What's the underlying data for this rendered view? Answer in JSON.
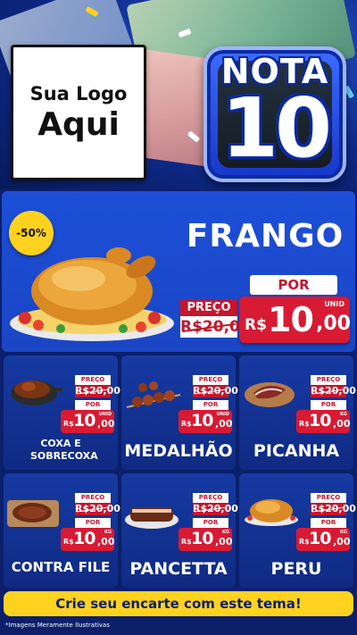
{
  "logo": {
    "line1": "Sua Logo",
    "line2": "Aqui"
  },
  "badge": {
    "word": "NOTA",
    "number": "10"
  },
  "featured": {
    "discount": "-50%",
    "title": "FRANGO",
    "preco_label": "PREÇO",
    "old_price": "R$20,00",
    "por_label": "POR",
    "currency": "R$",
    "price_int": "10",
    "price_cents": ",00",
    "unit": "UNID"
  },
  "products": [
    {
      "name": "COXA E SOBRECOXA",
      "preco_label": "PREÇO",
      "old_price": "R$20,00",
      "por_label": "POR",
      "currency": "R$",
      "price_int": "10",
      "price_cents": ",00",
      "unit": "UNID"
    },
    {
      "name": "MEDALHÃO",
      "preco_label": "PREÇO",
      "old_price": "R$20,00",
      "por_label": "POR",
      "currency": "R$",
      "price_int": "10",
      "price_cents": ",00",
      "unit": "UNID"
    },
    {
      "name": "PICANHA",
      "preco_label": "PREÇO",
      "old_price": "R$20,00",
      "por_label": "POR",
      "currency": "R$",
      "price_int": "10",
      "price_cents": ",00",
      "unit": "KG"
    },
    {
      "name": "CONTRA FILE",
      "preco_label": "PREÇO",
      "old_price": "R$20,00",
      "por_label": "POR",
      "currency": "R$",
      "price_int": "10",
      "price_cents": ",00",
      "unit": "KG"
    },
    {
      "name": "PANCETTA",
      "preco_label": "PREÇO",
      "old_price": "R$20,00",
      "por_label": "POR",
      "currency": "R$",
      "price_int": "10",
      "price_cents": ",00",
      "unit": "KG"
    },
    {
      "name": "PERU",
      "preco_label": "PREÇO",
      "old_price": "R$20,00",
      "por_label": "POR",
      "currency": "R$",
      "price_int": "10",
      "price_cents": ",00",
      "unit": "KG"
    }
  ],
  "cta": "Crie seu encarte com este tema!",
  "disclaimer": "*Imagens Meramente Ilustrativas",
  "colors": {
    "background": "#0b1f6b",
    "panel": "#1a46c4",
    "price_red": "#d81a33",
    "cta_yellow": "#ffd21f"
  }
}
